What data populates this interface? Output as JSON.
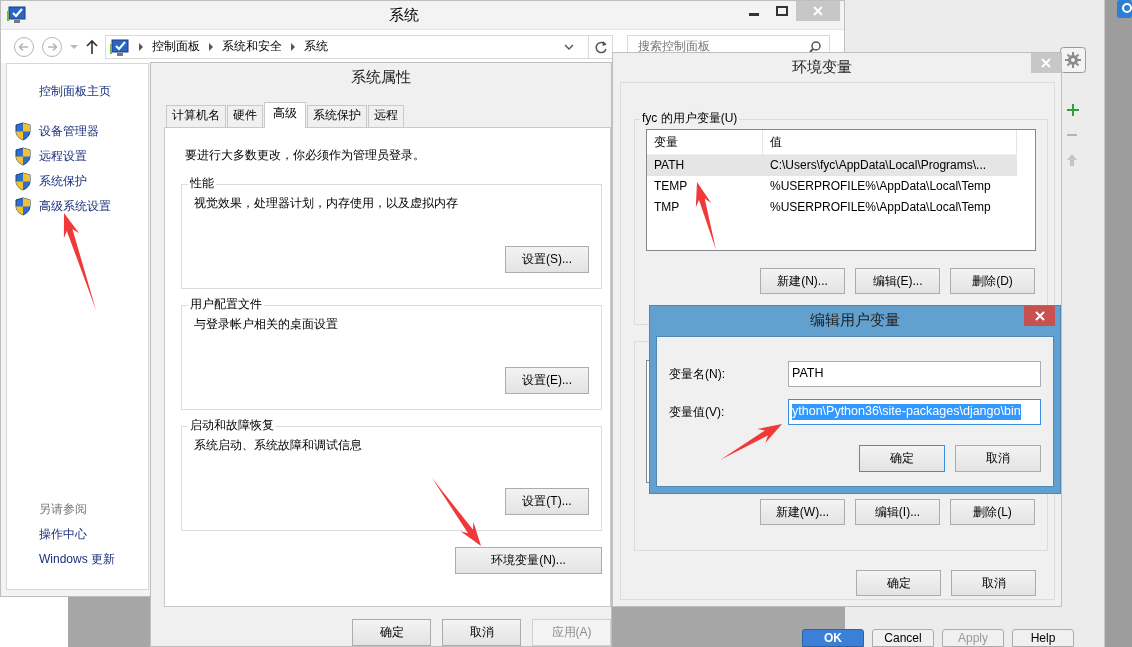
{
  "control_panel": {
    "title": "系统",
    "breadcrumb": [
      "控制面板",
      "系统和安全",
      "系统"
    ],
    "search": {
      "placeholder": "搜索控制面板"
    },
    "sidebar": {
      "home": "控制面板主页",
      "items": [
        "设备管理器",
        "远程设置",
        "系统保护",
        "高级系统设置"
      ],
      "see_also_heading": "另请参阅",
      "see_also": [
        "操作中心",
        "Windows 更新"
      ]
    }
  },
  "system_properties": {
    "title": "系统属性",
    "tabs": [
      {
        "label": "计算机名",
        "selected": false
      },
      {
        "label": "硬件",
        "selected": false
      },
      {
        "label": "高级",
        "selected": true
      },
      {
        "label": "系统保护",
        "selected": false
      },
      {
        "label": "远程",
        "selected": false
      }
    ],
    "notice": "要进行大多数更改，你必须作为管理员登录。",
    "groups": [
      {
        "title": "性能",
        "description": "视觉效果，处理器计划，内存使用，以及虚拟内存",
        "button": "设置(S)..."
      },
      {
        "title": "用户配置文件",
        "description": "与登录帐户相关的桌面设置",
        "button": "设置(E)..."
      },
      {
        "title": "启动和故障恢复",
        "description": "系统启动、系统故障和调试信息",
        "button": "设置(T)..."
      }
    ],
    "env_button": "环境变量(N)...",
    "buttons": [
      {
        "label": "确定",
        "disabled": false
      },
      {
        "label": "取消",
        "disabled": false
      },
      {
        "label": "应用(A)",
        "disabled": true
      }
    ]
  },
  "environment_variables": {
    "title": "环境变量",
    "user_group": "fyc 的用户变量(U)",
    "columns": [
      "变量",
      "值"
    ],
    "rows": [
      {
        "name": "PATH",
        "value": "C:\\Users\\fyc\\AppData\\Local\\Programs\\...",
        "selected": true
      },
      {
        "name": "TEMP",
        "value": "%USERPROFILE%\\AppData\\Local\\Temp",
        "selected": false
      },
      {
        "name": "TMP",
        "value": "%USERPROFILE%\\AppData\\Local\\Temp",
        "selected": false
      }
    ],
    "user_buttons": [
      "新建(N)...",
      "编辑(E)...",
      "删除(D)"
    ],
    "system_buttons": [
      "新建(W)...",
      "编辑(I)...",
      "删除(L)"
    ],
    "buttons": [
      "确定",
      "取消"
    ]
  },
  "edit_dialog": {
    "title": "编辑用户变量",
    "fields": [
      {
        "label": "变量名(N):",
        "value": "PATH",
        "selected": false
      },
      {
        "label": "变量值(V):",
        "value": "ython\\Python36\\site-packages\\django\\bin",
        "selected": true
      }
    ],
    "buttons": [
      {
        "label": "确定",
        "focused": true
      },
      {
        "label": "取消",
        "focused": false
      }
    ]
  },
  "background_window": {
    "buttons": [
      {
        "label": "OK",
        "kind": "primary",
        "disabled": false
      },
      {
        "label": "Cancel",
        "kind": "normal",
        "disabled": false
      },
      {
        "label": "Apply",
        "kind": "normal",
        "disabled": true
      },
      {
        "label": "Help",
        "kind": "normal",
        "disabled": false
      }
    ]
  }
}
